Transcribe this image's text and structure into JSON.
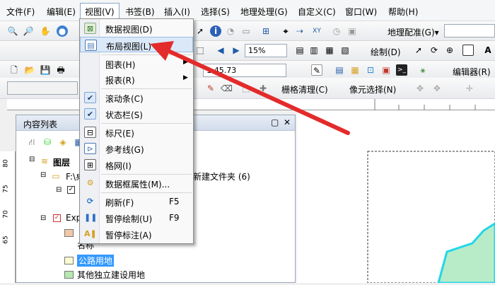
{
  "menubar": {
    "items": [
      "文件(F)",
      "编辑(E)",
      "视图(V)",
      "书签(B)",
      "插入(I)",
      "选择(S)",
      "地理处理(G)",
      "自定义(C)",
      "窗口(W)",
      "帮助(H)"
    ]
  },
  "toolbar1": {
    "scale": "15%",
    "georef_label": "地理配准(G)",
    "georef_arrow": "▾"
  },
  "toolbar2": {
    "scale_value": "1:45.73",
    "draw_label": "绘制(D)",
    "editor_label": "编辑器(R)"
  },
  "toolbar3": {
    "raster_clean": "栅格清理(C)",
    "pixel_select": "像元选择(N)"
  },
  "toc": {
    "title": "内容列表",
    "pin": "▢",
    "close": "✕",
    "layers_root": "图层",
    "folder_path": "F:\\桌",
    "new_folder": "新建文件夹 (6)",
    "exp_label": "Exp",
    "name_label": "名称",
    "item_road": "公路用地",
    "item_other": "其他独立建设用地",
    "road_color": "#fbfbd2",
    "other_color": "#b5e7b0",
    "top_swatch_color": "#f0c8a8"
  },
  "ruler": {
    "left_ticks": [
      "80",
      "75",
      "70",
      "65"
    ]
  },
  "dropdown": {
    "items": [
      {
        "label": "数据视图(D)",
        "shortcut": "",
        "arrow": "",
        "icon": "data-view-icon"
      },
      {
        "label": "布局视图(L)",
        "shortcut": "",
        "arrow": "",
        "icon": "layout-view-icon"
      },
      {
        "label": "图表(H)",
        "shortcut": "",
        "arrow": "▶",
        "icon": ""
      },
      {
        "label": "报表(R)",
        "shortcut": "",
        "arrow": "▶",
        "icon": ""
      },
      {
        "label": "滚动条(C)",
        "shortcut": "",
        "arrow": "",
        "icon": "check-icon"
      },
      {
        "label": "状态栏(S)",
        "shortcut": "",
        "arrow": "",
        "icon": "check-icon"
      },
      {
        "label": "标尺(E)",
        "shortcut": "",
        "arrow": "",
        "icon": "ruler-icon"
      },
      {
        "label": "参考线(G)",
        "shortcut": "",
        "arrow": "",
        "icon": "guide-icon"
      },
      {
        "label": "格网(I)",
        "shortcut": "",
        "arrow": "",
        "icon": "grid-icon"
      },
      {
        "label": "数据框属性(M)...",
        "shortcut": "",
        "arrow": "",
        "icon": "properties-icon"
      },
      {
        "label": "刷新(F)",
        "shortcut": "F5",
        "arrow": "",
        "icon": "refresh-icon"
      },
      {
        "label": "暂停绘制(U)",
        "shortcut": "F9",
        "arrow": "",
        "icon": "pause-icon"
      },
      {
        "label": "暂停标注(A)",
        "shortcut": "",
        "arrow": "",
        "icon": "label-pause-icon"
      }
    ]
  },
  "colors": {
    "arrow": "#e32b2b",
    "highlight": "#dbe8f8",
    "map_polygon": "#b8ecc9",
    "map_outline": "#22d6e8"
  }
}
